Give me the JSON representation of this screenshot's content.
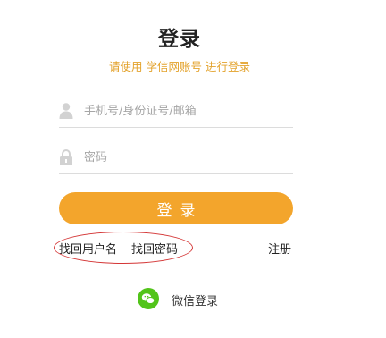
{
  "header": {
    "title": "登录",
    "subtitle": "请使用 学信网账号 进行登录"
  },
  "form": {
    "username_placeholder": "手机号/身份证号/邮箱",
    "password_placeholder": "密码",
    "submit_label": "登录"
  },
  "links": {
    "find_username": "找回用户名",
    "find_password": "找回密码",
    "register": "注册"
  },
  "wechat": {
    "label": "微信登录",
    "icon": "wechat-icon"
  },
  "colors": {
    "accent": "#f3a52c",
    "subtitle": "#e3a22b",
    "annotation": "#d43636",
    "wechat": "#52c41a"
  }
}
